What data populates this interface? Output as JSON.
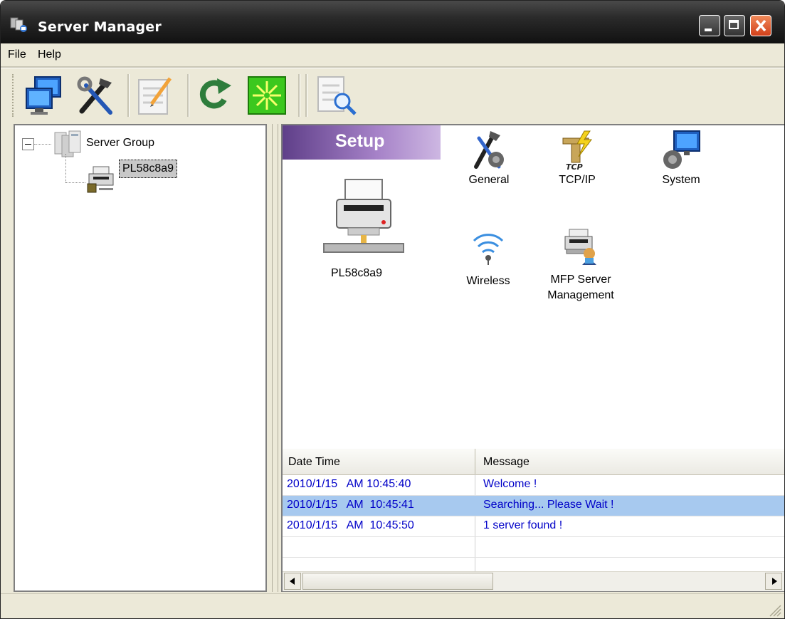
{
  "window": {
    "title": "Server Manager"
  },
  "menu": {
    "items": [
      "File",
      "Help"
    ]
  },
  "toolbar": {
    "tools": [
      "network-computers-icon",
      "tools-icon",
      "edit-document-icon",
      "refresh-icon",
      "search-servers-icon",
      "document-preview-icon"
    ]
  },
  "tree": {
    "group_label": "Server Group",
    "server_label": "PL58c8a9"
  },
  "setup": {
    "banner": "Setup",
    "device_name": "PL58c8a9",
    "items": [
      {
        "label": "General",
        "icon": "general-tools-icon"
      },
      {
        "label": "TCP/IP",
        "icon": "tcpip-icon"
      },
      {
        "label": "System",
        "icon": "system-icon"
      },
      {
        "label": "Wireless",
        "icon": "wireless-icon"
      },
      {
        "label": "MFP Server Management",
        "icon": "mfp-management-icon"
      }
    ],
    "tcp_icon_text": "TCP"
  },
  "log": {
    "columns": [
      "Date Time",
      "Message"
    ],
    "rows": [
      {
        "datetime": "2010/1/15   AM 10:45:40",
        "message": "Welcome !",
        "selected": false
      },
      {
        "datetime": "2010/1/15   AM  10:45:41",
        "message": "Searching... Please Wait !",
        "selected": true
      },
      {
        "datetime": "2010/1/15   AM  10:45:50",
        "message": "1 server found !",
        "selected": false
      }
    ]
  },
  "colors": {
    "log_text": "#0000c8",
    "selection": "#a7c9ef",
    "banner": "#5f3f89"
  }
}
